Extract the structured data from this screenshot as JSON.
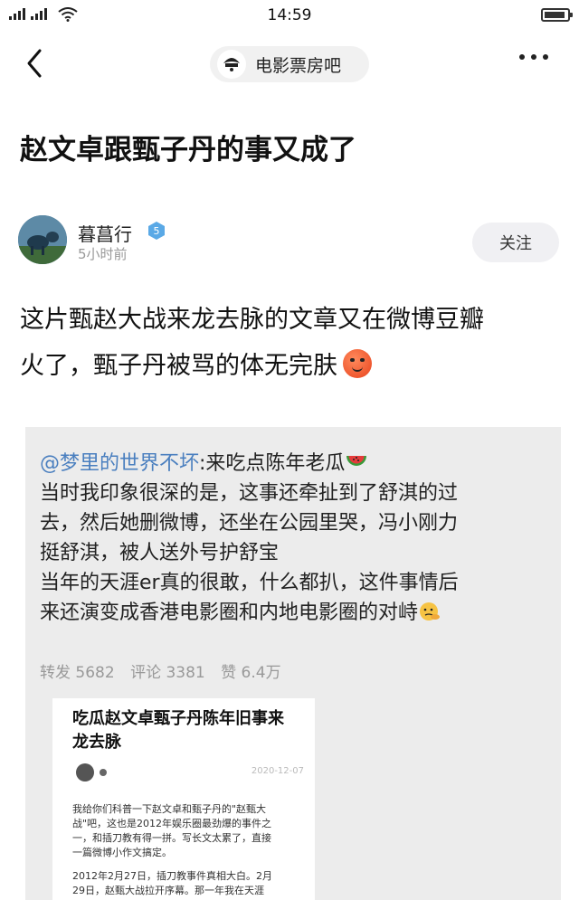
{
  "status_bar": {
    "time": "14:59"
  },
  "nav": {
    "forum_name": "电影票房吧",
    "forum_logo_text": "电影票房"
  },
  "post": {
    "title": "赵文卓跟甄子丹的事又成了",
    "author": {
      "name": "暮菖行",
      "level": "5",
      "time": "5小时前",
      "follow_label": "关注"
    },
    "body_line1": "这片甄赵大战来龙去脉的文章又在微博豆瓣",
    "body_line2": "火了，甄子丹被骂的体无完肤",
    "body_emoji": "angry-face-emoji"
  },
  "embed": {
    "mention": "@梦里的世界不坏",
    "line1_rest": ":来吃点陈年老瓜",
    "line2": "当时我印象很深的是，这事还牵扯到了舒淇的过",
    "line3": "去，然后她删微博，还坐在公园里哭，冯小刚力",
    "line4": "挺舒淇，被人送外号护舒宝",
    "line5": "当年的天涯er真的很敢，什么都扒，这件事情后",
    "line6": "来还演变成香港电影圈和内地电影圈的对峙",
    "stats": {
      "repost": "转发 5682",
      "comment": "评论 3381",
      "like": "赞 6.4万"
    },
    "article": {
      "title_line1": "吃瓜赵文卓甄子丹陈年旧事来",
      "title_line2": "龙去脉",
      "date": "2020-12-07",
      "para1_line1": "我给你们科普一下赵文卓和甄子丹的\"赵甄大",
      "para1_line2": "战\"吧，这也是2012年娱乐圈最劲爆的事件之",
      "para1_line3": "一，和插刀教有得一拼。写长文太累了，直接",
      "para1_line4": "一篇微博小作文搞定。",
      "para2_line1": "2012年2月27日，插刀教事件真相大白。2月",
      "para2_line2": "29日，赵甄大战拉开序幕。那一年我在天涯"
    }
  },
  "colors": {
    "mention": "#4a7fbf",
    "follow_bg": "#f0f0f3",
    "level_badge": "#5aa9e6"
  }
}
